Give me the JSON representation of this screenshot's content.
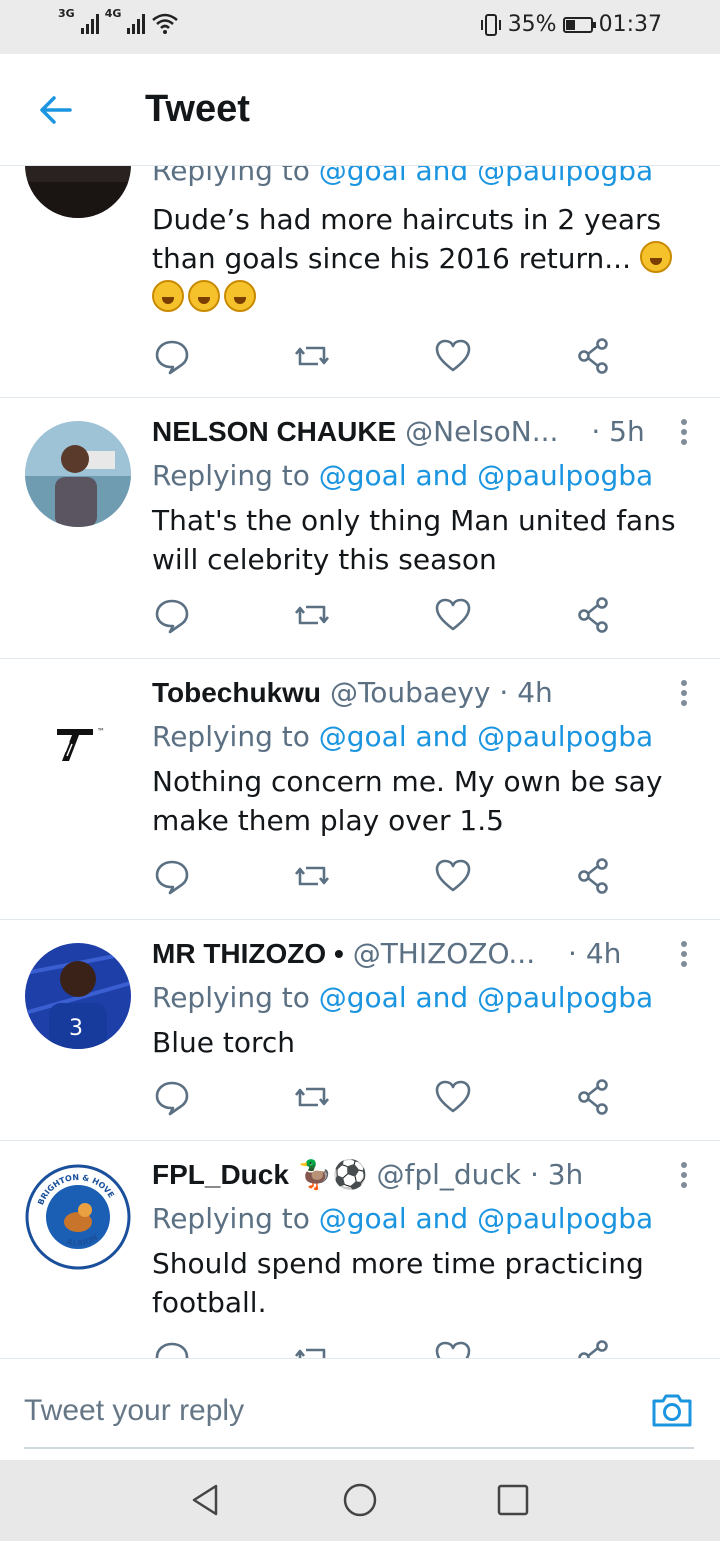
{
  "status_bar": {
    "network1": "3G",
    "network2": "4G",
    "battery": "35%",
    "time": "01:37"
  },
  "header": {
    "title": "Tweet"
  },
  "replying_prefix": "Replying to ",
  "mention_text": "@goal and @paulpogba",
  "tweets": [
    {
      "name": "",
      "handle": "",
      "time": "",
      "text": "Dude’s had more haircuts in 2 years than goals since his 2016 return...",
      "emoji_count": 4
    },
    {
      "name": "NELSON CHAUKE",
      "handle": "@NelsoN...",
      "time": "· 5h",
      "text": "That's the only thing Man united fans will celebrity this season"
    },
    {
      "name": "Tobechukwu",
      "handle": "@Toubaeyy",
      "time": "· 4h",
      "text": "Nothing concern me. My own be say make them play over 1.5"
    },
    {
      "name": "MR THIZOZO •",
      "handle": "@THIZOZO...",
      "time": "· 4h",
      "text": "Blue torch"
    },
    {
      "name": "FPL_Duck",
      "name_emojis": "🦆⚽",
      "handle": "@fpl_duck",
      "time": "· 3h",
      "text": "Should spend more time practicing football."
    }
  ],
  "avatar_badge": {
    "top_text": "BRIGHTON & HOVE",
    "bottom_text": "ALBION",
    "logo_letter": "T"
  },
  "composer": {
    "placeholder": "Tweet your reply"
  },
  "colors": {
    "link": "#1b95e0",
    "secondary_text": "#5b7083",
    "divider": "#e1e8ed"
  },
  "icons": [
    "back-arrow-icon",
    "reply-icon",
    "retweet-icon",
    "like-icon",
    "share-icon",
    "camera-icon",
    "more-icon",
    "nav-back-icon",
    "nav-home-icon",
    "nav-recents-icon"
  ]
}
